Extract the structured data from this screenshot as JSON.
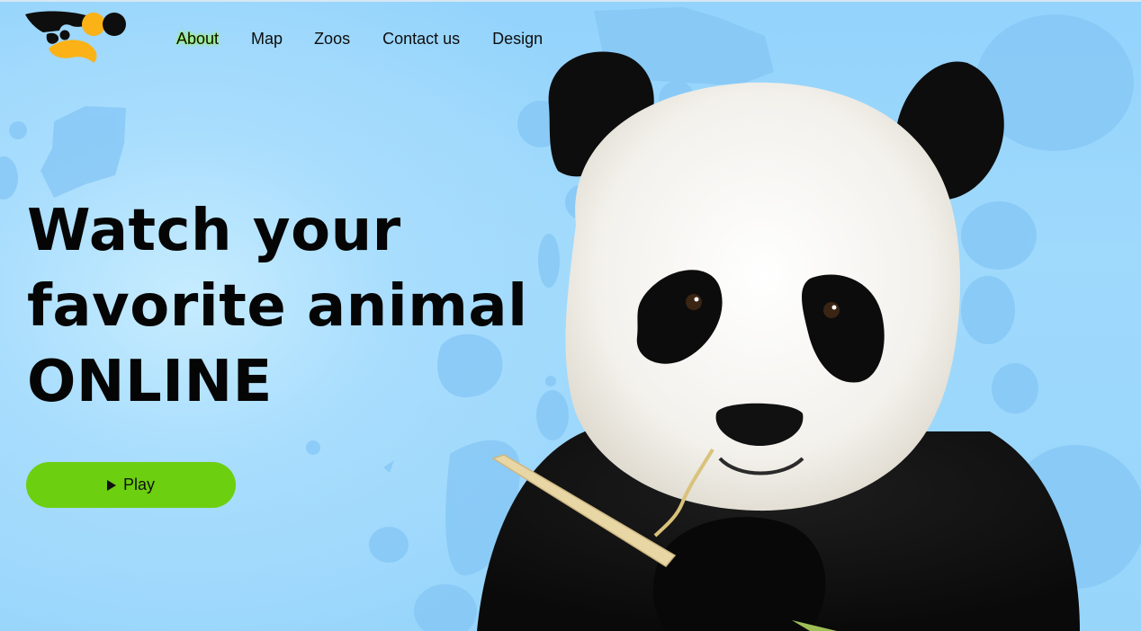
{
  "nav": {
    "items": [
      {
        "label": "About",
        "active": true
      },
      {
        "label": "Map"
      },
      {
        "label": "Zoos"
      },
      {
        "label": "Contact us"
      },
      {
        "label": "Design"
      }
    ]
  },
  "hero": {
    "headline": [
      "Watch your",
      "favorite animal",
      "ONLINE"
    ],
    "play_label": "Play"
  },
  "colors": {
    "background": "#9ed7fb",
    "accent_green": "#6ccf0f",
    "logo_yellow": "#fbb216",
    "logo_black": "#0e0e0e",
    "text": "#050505"
  },
  "icons": {
    "play": "play-triangle-icon",
    "logo": "brand-logo-icon"
  },
  "image": {
    "subject": "panda-eating-bamboo"
  }
}
